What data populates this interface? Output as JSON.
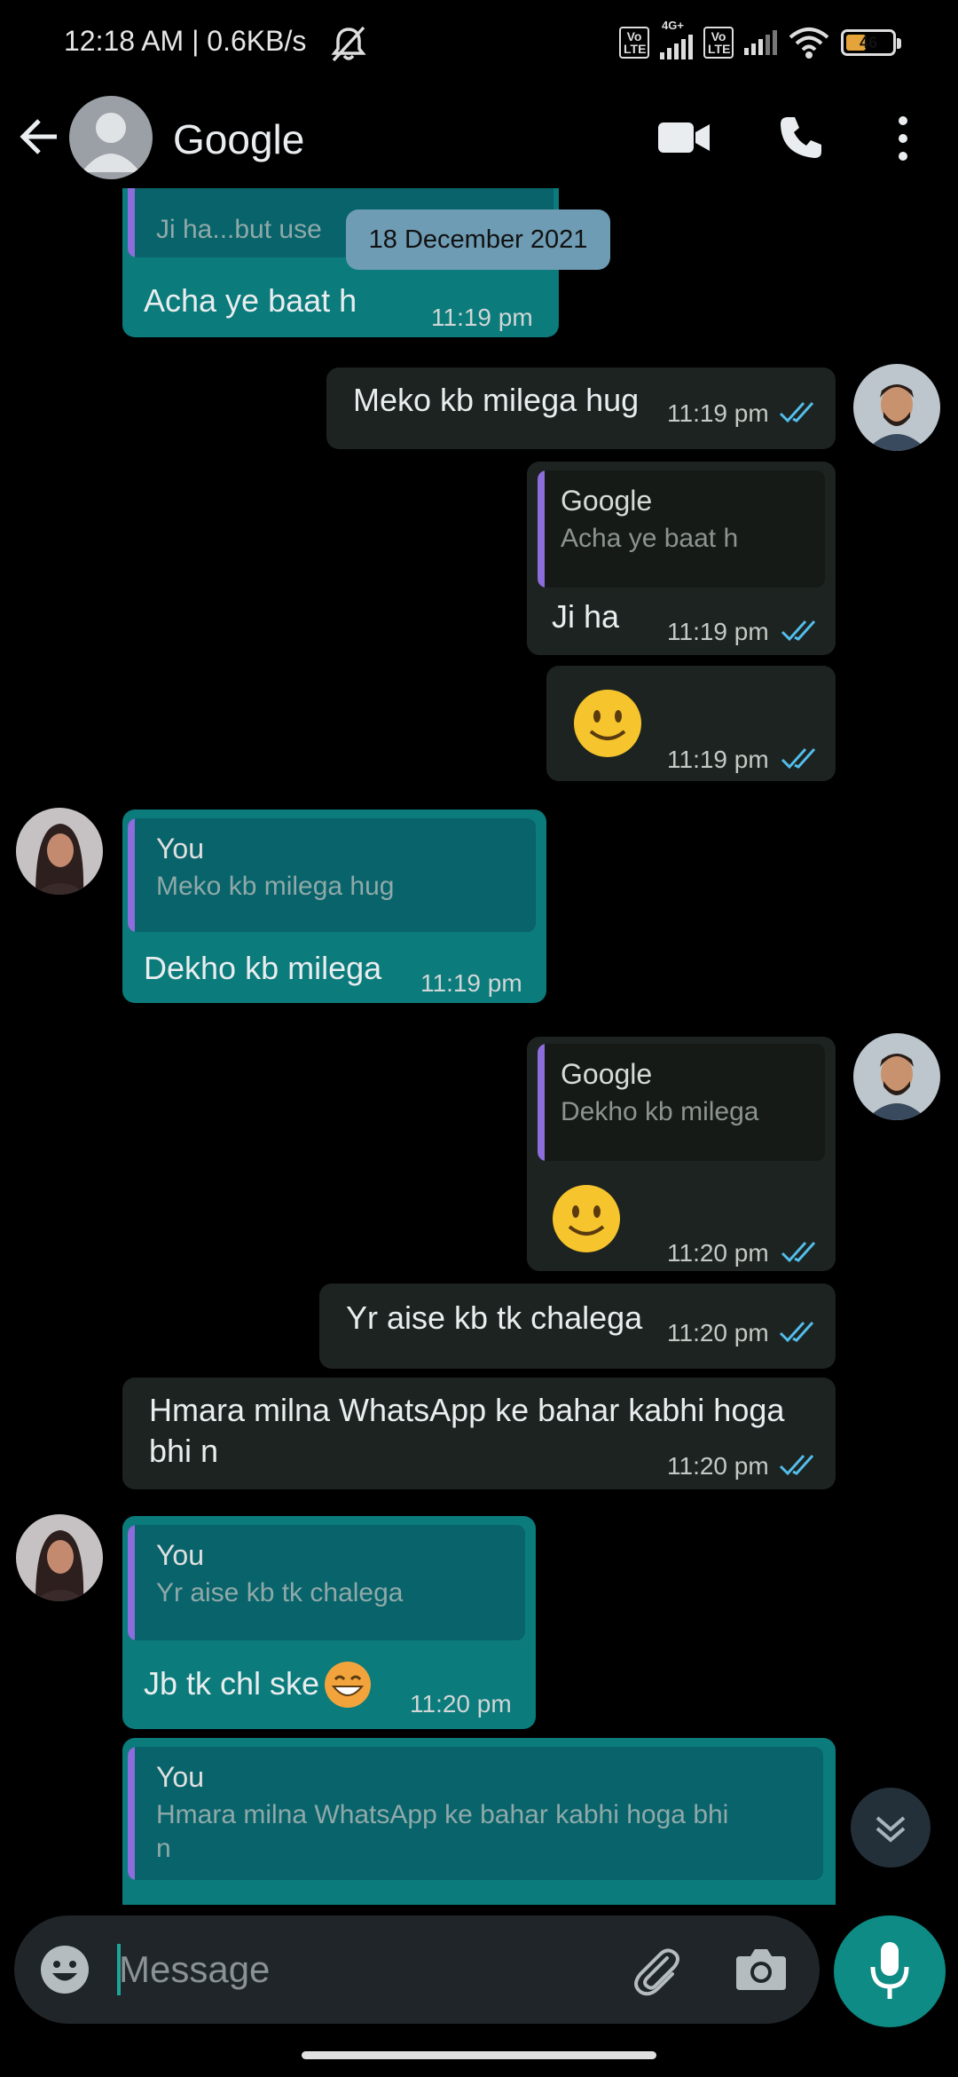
{
  "status_bar": {
    "time_speed": "12:18 AM | 0.6KB/s",
    "volte1": "Vo LTE",
    "network_label": "4G+",
    "volte2": "Vo LTE",
    "battery": "46"
  },
  "header": {
    "contact_name": "Google"
  },
  "date_chip": "18 December 2021",
  "messages": [
    {
      "direction": "in",
      "quote_text": "Ji ha...but use",
      "text": "Acha ye baat h",
      "time": "11:19 pm"
    },
    {
      "direction": "out",
      "text": "Meko kb milega hug",
      "time": "11:19 pm"
    },
    {
      "direction": "out",
      "quote_name": "Google",
      "quote_text": "Acha ye baat h",
      "text": "Ji ha",
      "time": "11:19 pm"
    },
    {
      "direction": "out",
      "emoji": "slightly-smiling-face",
      "time": "11:19 pm"
    },
    {
      "direction": "in",
      "quote_name": "You",
      "quote_text": "Meko kb milega hug",
      "text": "Dekho kb milega",
      "time": "11:19 pm"
    },
    {
      "direction": "out",
      "quote_name": "Google",
      "quote_text": "Dekho kb milega",
      "emoji": "slightly-smiling-face",
      "time": "11:20 pm"
    },
    {
      "direction": "out",
      "text": "Yr aise kb tk chalega",
      "time": "11:20 pm"
    },
    {
      "direction": "out",
      "text_line1": "Hmara milna WhatsApp ke bahar kabhi hoga",
      "text_line2": "bhi n",
      "time": "11:20 pm"
    },
    {
      "direction": "in",
      "quote_name": "You",
      "quote_text": "Yr aise kb tk chalega",
      "text": "Jb tk chl ske",
      "time": "11:20 pm"
    },
    {
      "direction": "in",
      "quote_name": "You",
      "quote_line1": "Hmara milna WhatsApp ke bahar kabhi hoga bhi",
      "quote_line2": "n"
    }
  ],
  "composer": {
    "placeholder": "Message"
  },
  "colors": {
    "incoming_bubble": "#0b7b7b",
    "outgoing_bubble": "#1d2320",
    "read_ticks": "#53bdeb",
    "quote_bar": "#8d6cdb",
    "accent": "#0d8b84"
  }
}
